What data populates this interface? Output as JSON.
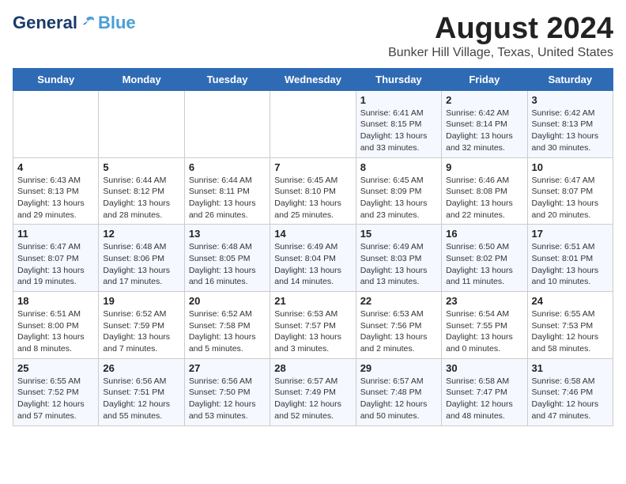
{
  "logo": {
    "general": "General",
    "blue": "Blue"
  },
  "title": "August 2024",
  "subtitle": "Bunker Hill Village, Texas, United States",
  "weekdays": [
    "Sunday",
    "Monday",
    "Tuesday",
    "Wednesday",
    "Thursday",
    "Friday",
    "Saturday"
  ],
  "weeks": [
    [
      {
        "day": "",
        "info": ""
      },
      {
        "day": "",
        "info": ""
      },
      {
        "day": "",
        "info": ""
      },
      {
        "day": "",
        "info": ""
      },
      {
        "day": "1",
        "info": "Sunrise: 6:41 AM\nSunset: 8:15 PM\nDaylight: 13 hours\nand 33 minutes."
      },
      {
        "day": "2",
        "info": "Sunrise: 6:42 AM\nSunset: 8:14 PM\nDaylight: 13 hours\nand 32 minutes."
      },
      {
        "day": "3",
        "info": "Sunrise: 6:42 AM\nSunset: 8:13 PM\nDaylight: 13 hours\nand 30 minutes."
      }
    ],
    [
      {
        "day": "4",
        "info": "Sunrise: 6:43 AM\nSunset: 8:13 PM\nDaylight: 13 hours\nand 29 minutes."
      },
      {
        "day": "5",
        "info": "Sunrise: 6:44 AM\nSunset: 8:12 PM\nDaylight: 13 hours\nand 28 minutes."
      },
      {
        "day": "6",
        "info": "Sunrise: 6:44 AM\nSunset: 8:11 PM\nDaylight: 13 hours\nand 26 minutes."
      },
      {
        "day": "7",
        "info": "Sunrise: 6:45 AM\nSunset: 8:10 PM\nDaylight: 13 hours\nand 25 minutes."
      },
      {
        "day": "8",
        "info": "Sunrise: 6:45 AM\nSunset: 8:09 PM\nDaylight: 13 hours\nand 23 minutes."
      },
      {
        "day": "9",
        "info": "Sunrise: 6:46 AM\nSunset: 8:08 PM\nDaylight: 13 hours\nand 22 minutes."
      },
      {
        "day": "10",
        "info": "Sunrise: 6:47 AM\nSunset: 8:07 PM\nDaylight: 13 hours\nand 20 minutes."
      }
    ],
    [
      {
        "day": "11",
        "info": "Sunrise: 6:47 AM\nSunset: 8:07 PM\nDaylight: 13 hours\nand 19 minutes."
      },
      {
        "day": "12",
        "info": "Sunrise: 6:48 AM\nSunset: 8:06 PM\nDaylight: 13 hours\nand 17 minutes."
      },
      {
        "day": "13",
        "info": "Sunrise: 6:48 AM\nSunset: 8:05 PM\nDaylight: 13 hours\nand 16 minutes."
      },
      {
        "day": "14",
        "info": "Sunrise: 6:49 AM\nSunset: 8:04 PM\nDaylight: 13 hours\nand 14 minutes."
      },
      {
        "day": "15",
        "info": "Sunrise: 6:49 AM\nSunset: 8:03 PM\nDaylight: 13 hours\nand 13 minutes."
      },
      {
        "day": "16",
        "info": "Sunrise: 6:50 AM\nSunset: 8:02 PM\nDaylight: 13 hours\nand 11 minutes."
      },
      {
        "day": "17",
        "info": "Sunrise: 6:51 AM\nSunset: 8:01 PM\nDaylight: 13 hours\nand 10 minutes."
      }
    ],
    [
      {
        "day": "18",
        "info": "Sunrise: 6:51 AM\nSunset: 8:00 PM\nDaylight: 13 hours\nand 8 minutes."
      },
      {
        "day": "19",
        "info": "Sunrise: 6:52 AM\nSunset: 7:59 PM\nDaylight: 13 hours\nand 7 minutes."
      },
      {
        "day": "20",
        "info": "Sunrise: 6:52 AM\nSunset: 7:58 PM\nDaylight: 13 hours\nand 5 minutes."
      },
      {
        "day": "21",
        "info": "Sunrise: 6:53 AM\nSunset: 7:57 PM\nDaylight: 13 hours\nand 3 minutes."
      },
      {
        "day": "22",
        "info": "Sunrise: 6:53 AM\nSunset: 7:56 PM\nDaylight: 13 hours\nand 2 minutes."
      },
      {
        "day": "23",
        "info": "Sunrise: 6:54 AM\nSunset: 7:55 PM\nDaylight: 13 hours\nand 0 minutes."
      },
      {
        "day": "24",
        "info": "Sunrise: 6:55 AM\nSunset: 7:53 PM\nDaylight: 12 hours\nand 58 minutes."
      }
    ],
    [
      {
        "day": "25",
        "info": "Sunrise: 6:55 AM\nSunset: 7:52 PM\nDaylight: 12 hours\nand 57 minutes."
      },
      {
        "day": "26",
        "info": "Sunrise: 6:56 AM\nSunset: 7:51 PM\nDaylight: 12 hours\nand 55 minutes."
      },
      {
        "day": "27",
        "info": "Sunrise: 6:56 AM\nSunset: 7:50 PM\nDaylight: 12 hours\nand 53 minutes."
      },
      {
        "day": "28",
        "info": "Sunrise: 6:57 AM\nSunset: 7:49 PM\nDaylight: 12 hours\nand 52 minutes."
      },
      {
        "day": "29",
        "info": "Sunrise: 6:57 AM\nSunset: 7:48 PM\nDaylight: 12 hours\nand 50 minutes."
      },
      {
        "day": "30",
        "info": "Sunrise: 6:58 AM\nSunset: 7:47 PM\nDaylight: 12 hours\nand 48 minutes."
      },
      {
        "day": "31",
        "info": "Sunrise: 6:58 AM\nSunset: 7:46 PM\nDaylight: 12 hours\nand 47 minutes."
      }
    ]
  ]
}
